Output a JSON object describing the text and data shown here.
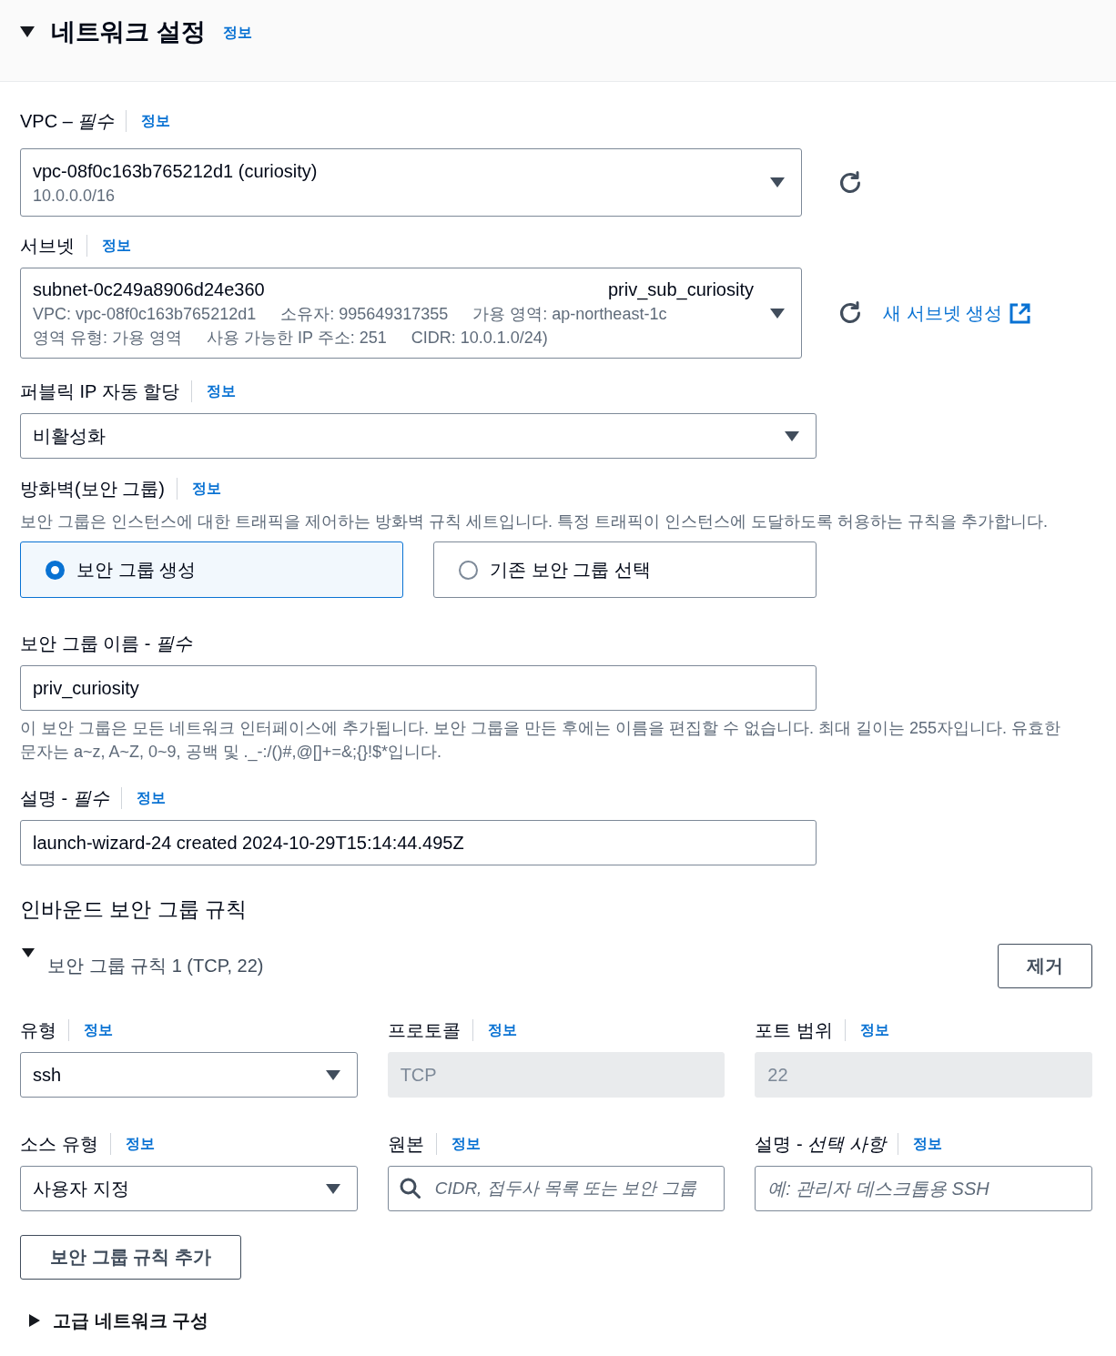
{
  "section": {
    "title": "네트워크 설정",
    "info_link": "정보",
    "expanded": true
  },
  "vpc": {
    "label": "VPC – *필수*",
    "info_link": "정보",
    "value": "vpc-08f0c163b765212d1 (curiosity)",
    "detail": "10.0.0.0/16"
  },
  "subnet": {
    "label": "서브넷",
    "info_link": "정보",
    "value": "subnet-0c249a8906d24e360",
    "name": "priv_sub_curiosity",
    "details": [
      [
        "VPC: vpc-08f0c163b765212d1",
        "소유자: 995649317355",
        "가용 영역: ap-northeast-1c"
      ],
      [
        "영역 유형: 가용 영역",
        "사용 가능한 IP 주소: 251",
        "CIDR: 10.0.1.0/24)"
      ]
    ],
    "create_link": "새 서브넷 생성"
  },
  "public_ip": {
    "label": "퍼블릭 IP 자동 할당",
    "info_link": "정보",
    "value": "비활성화"
  },
  "firewall": {
    "label": "방화벽(보안 그룹)",
    "info_link": "정보",
    "description": "보안 그룹은 인스턴스에 대한 트래픽을 제어하는 방화벽 규칙 세트입니다. 특정 트래픽이 인스턴스에 도달하도록 허용하는 규칙을 추가합니다.",
    "options": [
      {
        "label": "보안 그룹 생성",
        "selected": true
      },
      {
        "label": "기존 보안 그룹 선택",
        "selected": false
      }
    ]
  },
  "sg_name": {
    "label": "보안 그룹 이름 - *필수*",
    "value": "priv_curiosity",
    "help": "이 보안 그룹은 모든 네트워크 인터페이스에 추가됩니다. 보안 그룹을 만든 후에는 이름을 편집할 수 없습니다. 최대 길이는 255자입니다. 유효한 문자는 a~z, A~Z, 0~9, 공백 및 ._-:/()#,@[]+=&;{}!$*입니다."
  },
  "sg_description": {
    "label": "설명 - *필수*",
    "info_link": "정보",
    "value": "launch-wizard-24 created 2024-10-29T15:14:44.495Z"
  },
  "inbound": {
    "title": "인바운드 보안 그룹 규칙",
    "rules": [
      {
        "title": "보안 그룹 규칙 1 (TCP, 22)",
        "expanded": true,
        "remove_button": "제거",
        "fields": [
          {
            "label": "유형",
            "info_link": "정보",
            "kind": "select",
            "value": "ssh",
            "disabled": false
          },
          {
            "label": "프로토콜",
            "info_link": "정보",
            "kind": "text",
            "value": "TCP",
            "disabled": true
          },
          {
            "label": "포트 범위",
            "info_link": "정보",
            "kind": "text",
            "value": "22",
            "disabled": true
          },
          {
            "label": "소스 유형",
            "info_link": "정보",
            "kind": "select",
            "value": "사용자 지정",
            "disabled": false
          },
          {
            "label": "원본",
            "info_link": "정보",
            "kind": "search",
            "placeholder": "CIDR, 접두사 목록 또는 보안 그룹",
            "disabled": false
          },
          {
            "label": "설명 - *선택 사항*",
            "info_link": "정보",
            "kind": "text",
            "placeholder": "예: 관리자 데스크톱용 SSH",
            "disabled": false
          }
        ]
      }
    ],
    "add_button": "보안 그룹 규칙 추가"
  },
  "advanced": {
    "title": "고급 네트워크 구성",
    "expanded": false
  }
}
